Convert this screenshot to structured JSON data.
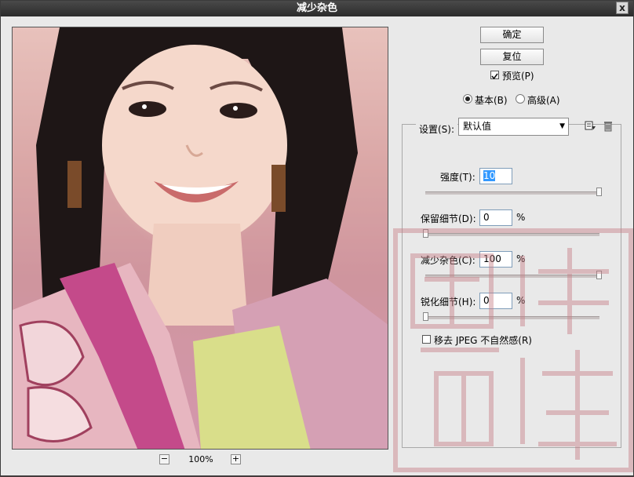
{
  "window": {
    "title": "减少杂色",
    "close_label": "x"
  },
  "preview": {
    "zoom_out": "−",
    "zoom_in": "+",
    "zoom_level": "100%"
  },
  "buttons": {
    "ok": "确定",
    "reset": "复位"
  },
  "preview_toggle": {
    "label": "预览(P)",
    "checked": true
  },
  "mode": {
    "basic": {
      "label": "基本(B)",
      "selected": true
    },
    "advanced": {
      "label": "高级(A)",
      "selected": false
    }
  },
  "settings": {
    "label": "设置(S):",
    "value": "默认值"
  },
  "controls": {
    "strength": {
      "label": "强度(T):",
      "value": "10",
      "unit": "",
      "slider": 1.0
    },
    "preserve_details": {
      "label": "保留细节(D):",
      "value": "0",
      "unit": "%",
      "slider": 0.0
    },
    "reduce_color_noise": {
      "label": "减少杂色(C):",
      "value": "100",
      "unit": "%",
      "slider": 1.0
    },
    "sharpen_details": {
      "label": "锐化细节(H):",
      "value": "0",
      "unit": "%",
      "slider": 0.0
    }
  },
  "jpeg_artifact": {
    "label": "移去 JPEG 不自然感(R)",
    "checked": false
  },
  "icons": {
    "save": "save-preset-icon",
    "delete": "trash-icon"
  },
  "colors": {
    "title_bg": "#2b2b2b",
    "accent": "#3399ff",
    "watermark": "#c77f86"
  }
}
